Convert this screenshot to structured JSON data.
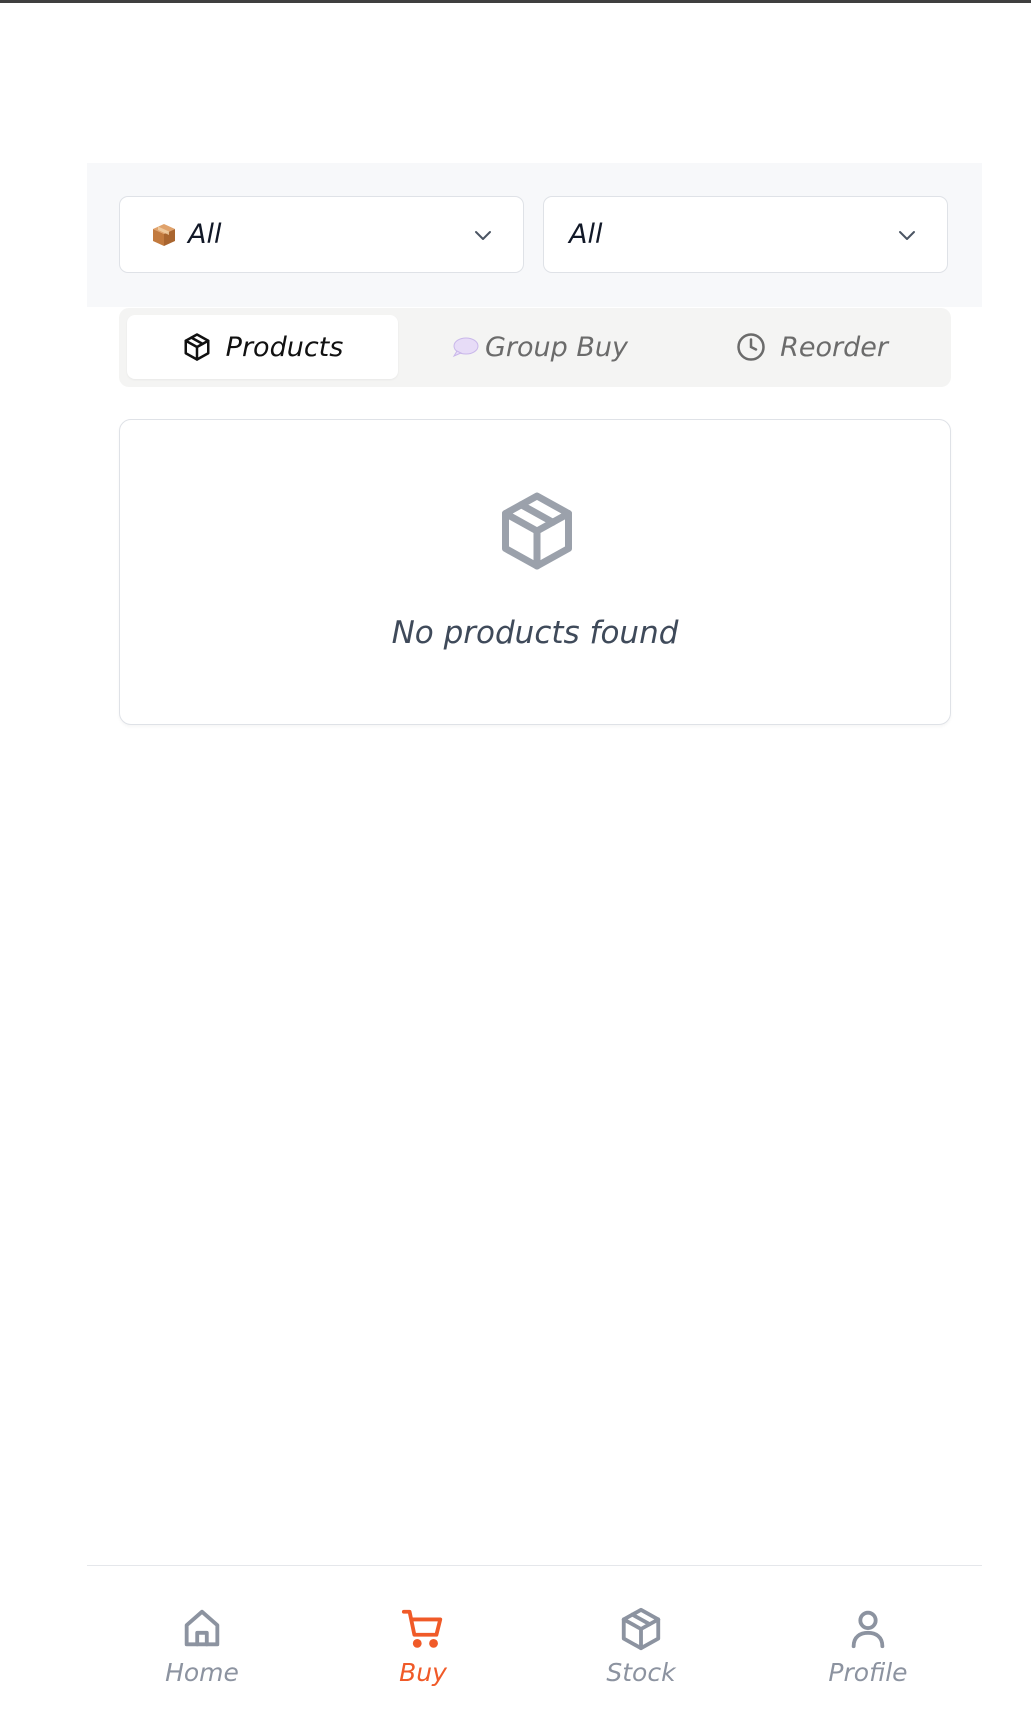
{
  "filters": {
    "category": {
      "icon": "package-emoji-icon",
      "value": "All"
    },
    "secondary": {
      "value": "All"
    }
  },
  "tabs": [
    {
      "label": "Products",
      "icon": "cube-icon",
      "active": true
    },
    {
      "label": "Group Buy",
      "icon": "speech-bubble-icon",
      "active": false
    },
    {
      "label": "Reorder",
      "icon": "clock-icon",
      "active": false
    }
  ],
  "empty_state": {
    "icon": "cube-icon",
    "message": "No products found"
  },
  "bottom_nav": [
    {
      "label": "Home",
      "icon": "home-icon",
      "active": false
    },
    {
      "label": "Buy",
      "icon": "cart-icon",
      "active": true
    },
    {
      "label": "Stock",
      "icon": "cube-icon",
      "active": false
    },
    {
      "label": "Profile",
      "icon": "user-icon",
      "active": false
    }
  ],
  "colors": {
    "accent": "#f05a28",
    "muted": "#8c93a0",
    "filter_bar_bg": "#f7f8fa",
    "tabs_bg": "#f4f4f3"
  }
}
